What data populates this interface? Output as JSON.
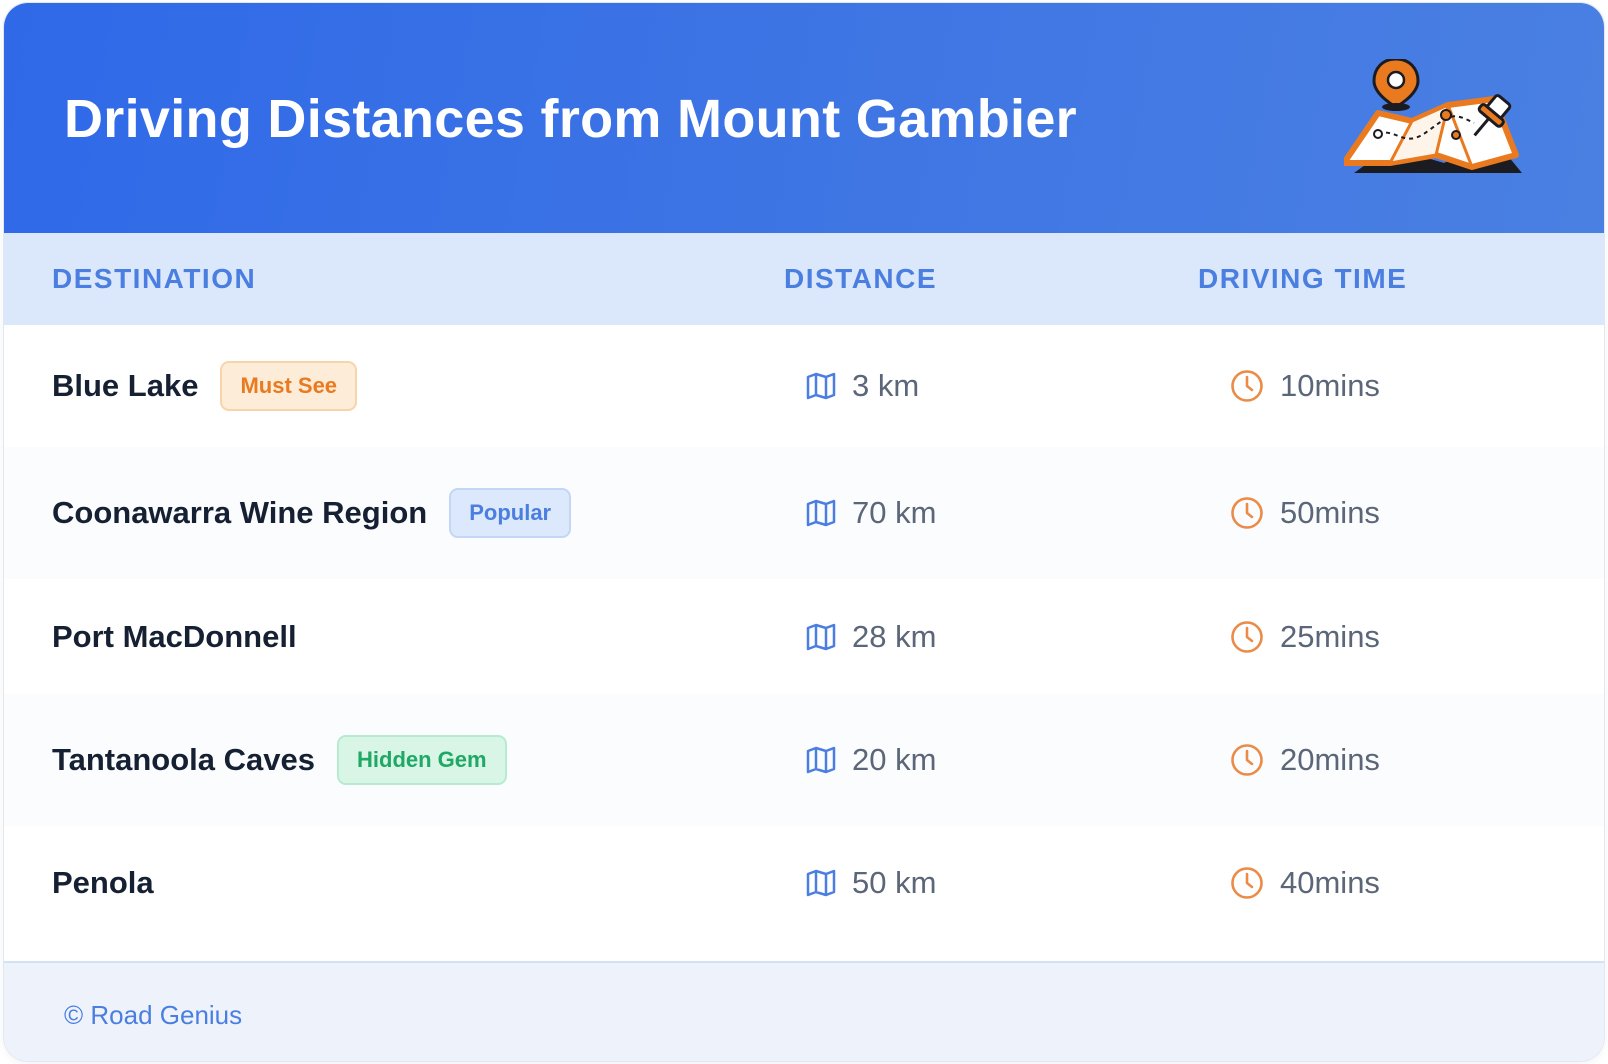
{
  "header": {
    "title": "Driving Distances from Mount Gambier",
    "illustration_icon": "map-with-pins-icon"
  },
  "columns": {
    "destination": "DESTINATION",
    "distance": "DISTANCE",
    "driving_time": "DRIVING TIME"
  },
  "rows": [
    {
      "destination": "Blue Lake",
      "badge": "Must See",
      "badge_color": "#ea7a1f",
      "distance": "3 km",
      "time": "10mins"
    },
    {
      "destination": "Coonawarra Wine Region",
      "badge": "Popular",
      "badge_color": "#4a7ee0",
      "distance": "70 km",
      "time": "50mins"
    },
    {
      "destination": "Port MacDonnell",
      "badge": "",
      "distance": "28 km",
      "time": "25mins"
    },
    {
      "destination": "Tantanoola Caves",
      "badge": "Hidden Gem",
      "badge_color": "#1fa866",
      "distance": "20 km",
      "time": "20mins"
    },
    {
      "destination": "Penola",
      "badge": "",
      "distance": "50 km",
      "time": "40mins"
    }
  ],
  "icons": {
    "distance": "map-icon",
    "time": "clock-icon"
  },
  "colors": {
    "header_blue": "#2f69e8",
    "accent_blue": "#4a7ee0",
    "accent_orange": "#ea7a1f",
    "accent_green": "#1fa866"
  },
  "footer": {
    "text": "© Road Genius"
  }
}
